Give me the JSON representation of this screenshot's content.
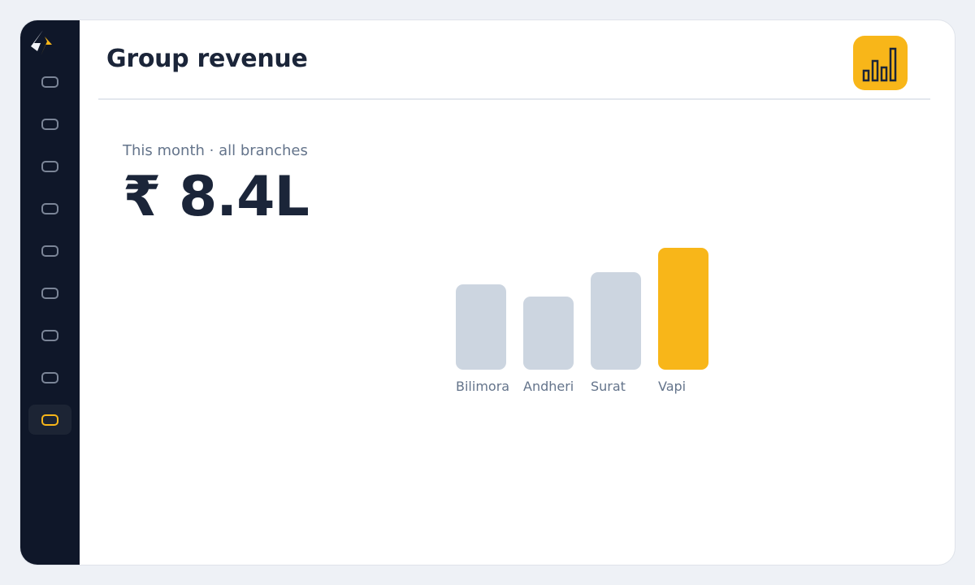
{
  "app": {
    "title": "Group revenue"
  },
  "sidebar": {
    "items": [
      {
        "icon": "nav-icon-1",
        "active": false
      },
      {
        "icon": "nav-icon-2",
        "active": false
      },
      {
        "icon": "nav-icon-3",
        "active": false
      },
      {
        "icon": "nav-icon-4",
        "active": false
      },
      {
        "icon": "nav-icon-5",
        "active": false
      },
      {
        "icon": "nav-icon-6",
        "active": false
      },
      {
        "icon": "nav-icon-7",
        "active": false
      },
      {
        "icon": "nav-icon-8",
        "active": false
      },
      {
        "icon": "nav-icon-9",
        "active": true
      }
    ]
  },
  "summary": {
    "subtitle": "This month · all branches",
    "value": "₹ 8.4L"
  },
  "colors": {
    "accent": "#f8b619",
    "bar_default": "#ccd5e0",
    "sidebar_bg": "#0f1729",
    "text_dark": "#1b2539",
    "text_muted": "#64748b"
  },
  "chart_data": {
    "type": "bar",
    "categories": [
      "Bilimora",
      "Andheri",
      "Surat",
      "Vapi"
    ],
    "values": [
      105,
      90,
      120,
      150
    ],
    "highlight": "Vapi",
    "title": "",
    "xlabel": "",
    "ylabel": ""
  }
}
